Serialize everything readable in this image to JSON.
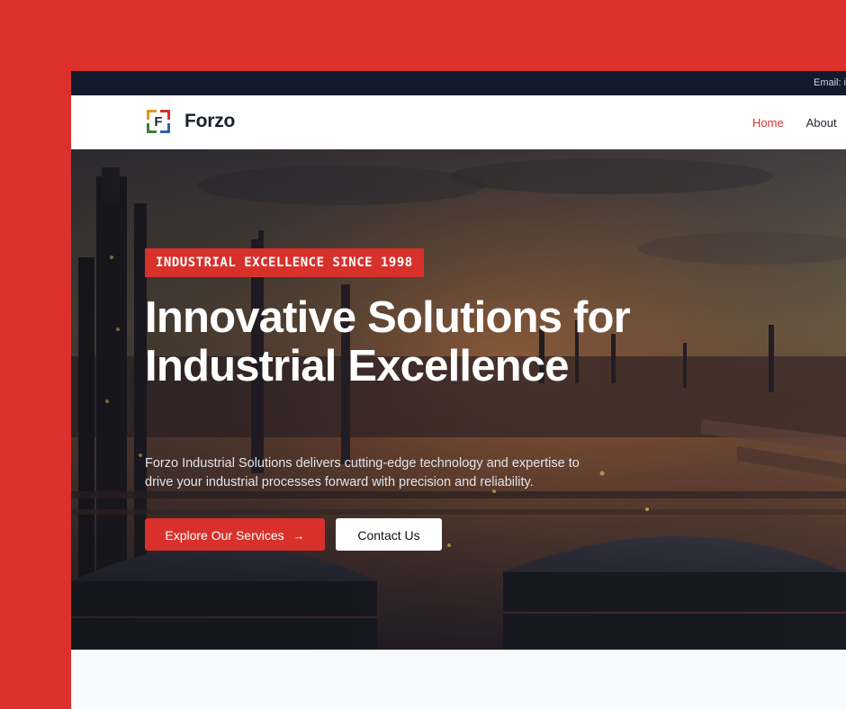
{
  "topbar": {
    "email_label": "Email: i"
  },
  "brand": {
    "logo_letter": "F",
    "name": "Forzo"
  },
  "nav": [
    {
      "label": "Home",
      "active": true
    },
    {
      "label": "About",
      "active": false
    }
  ],
  "hero": {
    "badge": "INDUSTRIAL EXCELLENCE SINCE 1998",
    "headline": "Innovative Solutions for Industrial Excellence",
    "subtitle": "Forzo Industrial Solutions delivers cutting-edge technology and expertise to drive your industrial processes forward with precision and reliability.",
    "primary_button": "Explore Our Services",
    "primary_icon": "arrow-right-icon",
    "secondary_button": "Contact Us"
  },
  "colors": {
    "accent": "#d8302b",
    "topbar": "#121a2c",
    "frame": "#dc302c"
  }
}
